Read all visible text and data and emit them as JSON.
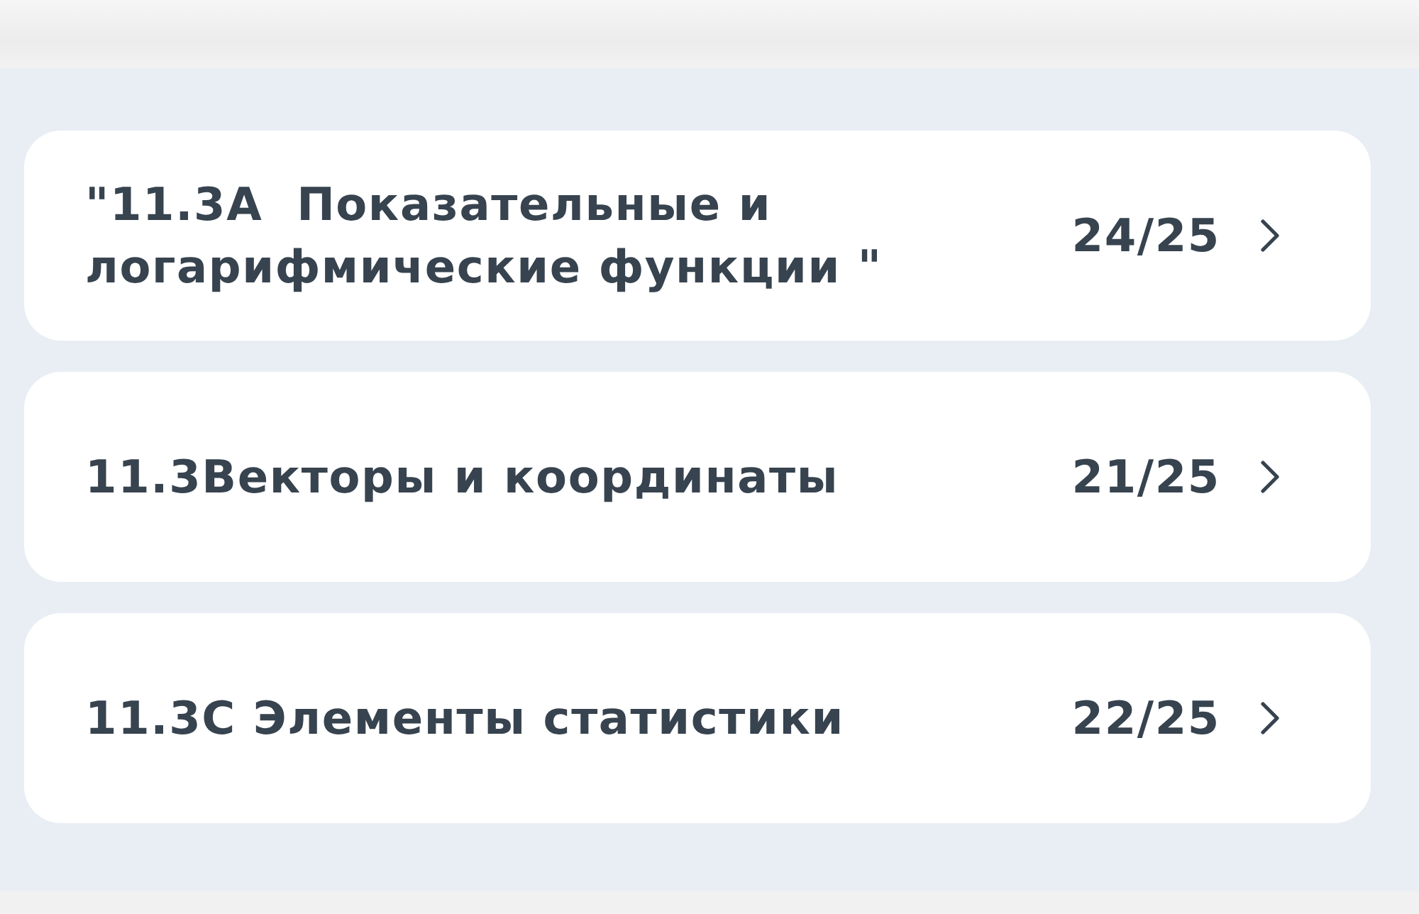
{
  "topics": [
    {
      "title": "\"11.3A  Показательные и логарифмические функции \"",
      "score": "24/25"
    },
    {
      "title": "11.3Векторы и координаты",
      "score": "21/25"
    },
    {
      "title": "11.3C Элементы статистики",
      "score": "22/25"
    }
  ]
}
